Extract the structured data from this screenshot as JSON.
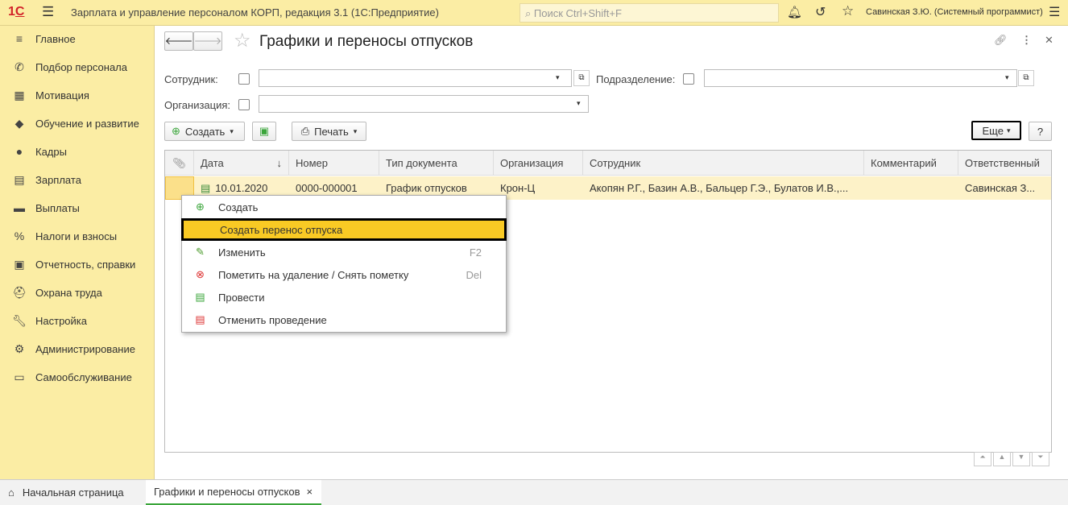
{
  "app": {
    "title": "Зарплата и управление персоналом КОРП, редакция 3.1  (1С:Предприятие)",
    "search_placeholder": "Поиск Ctrl+Shift+F",
    "user": "Савинская З.Ю. (Системный программист)",
    "logo": "1С"
  },
  "sidebar": {
    "items": [
      {
        "label": "Главное",
        "icon": "menu-icon"
      },
      {
        "label": "Подбор персонала",
        "icon": "phone-icon"
      },
      {
        "label": "Мотивация",
        "icon": "gift-icon"
      },
      {
        "label": "Обучение и развитие",
        "icon": "graduation-icon"
      },
      {
        "label": "Кадры",
        "icon": "people-icon"
      },
      {
        "label": "Зарплата",
        "icon": "calculator-icon"
      },
      {
        "label": "Выплаты",
        "icon": "wallet-icon"
      },
      {
        "label": "Налоги и взносы",
        "icon": "percent-icon"
      },
      {
        "label": "Отчетность, справки",
        "icon": "reports-icon"
      },
      {
        "label": "Охрана труда",
        "icon": "helmet-icon"
      },
      {
        "label": "Настройка",
        "icon": "wrench-icon"
      },
      {
        "label": "Администрирование",
        "icon": "gear-icon"
      },
      {
        "label": "Самообслуживание",
        "icon": "id-card-icon"
      }
    ]
  },
  "page": {
    "title": "Графики и переносы отпусков"
  },
  "filters": {
    "employee_label": "Сотрудник:",
    "employee_value": "",
    "department_label": "Подразделение:",
    "department_value": "",
    "organization_label": "Организация:",
    "organization_value": ""
  },
  "toolbar": {
    "create": "Создать",
    "print": "Печать",
    "more": "Еще",
    "help": "?"
  },
  "table": {
    "columns": [
      "Дата",
      "Номер",
      "Тип документа",
      "Организация",
      "Сотрудник",
      "Комментарий",
      "Ответственный"
    ],
    "rows": [
      {
        "date": "10.01.2020",
        "number": "0000-000001",
        "type": "График отпусков",
        "organization": "Крон-Ц",
        "employee": "Акопян Р.Г., Базин А.В., Бальцер Г.Э., Булатов И.В.,...",
        "comment": "",
        "responsible": "Савинская З..."
      }
    ]
  },
  "context_menu": {
    "items": [
      {
        "label": "Создать",
        "shortcut": "",
        "icon": "plus-circle-icon"
      },
      {
        "label": "Создать перенос отпуска",
        "shortcut": "",
        "icon": ""
      },
      {
        "label": "Изменить",
        "shortcut": "F2",
        "icon": "pencil-icon"
      },
      {
        "label": "Пометить на удаление / Снять пометку",
        "shortcut": "Del",
        "icon": "delete-mark-icon"
      },
      {
        "label": "Провести",
        "shortcut": "",
        "icon": "post-icon"
      },
      {
        "label": "Отменить проведение",
        "shortcut": "",
        "icon": "unpost-icon"
      }
    ]
  },
  "tabs": {
    "home": "Начальная страница",
    "current": "Графики и переносы отпусков"
  },
  "colors": {
    "panel": "#fbeda4",
    "highlight": "#f9ca24",
    "row": "#fdf2c8"
  }
}
